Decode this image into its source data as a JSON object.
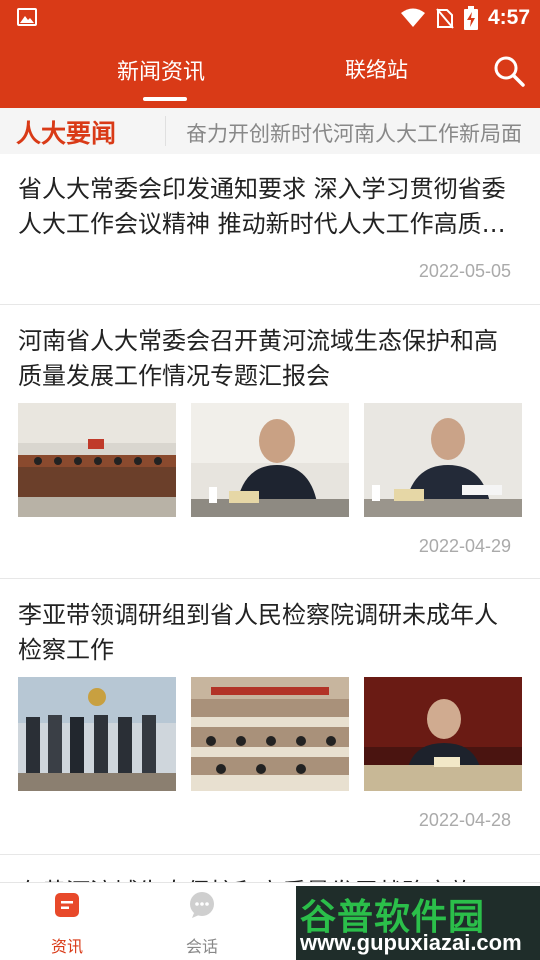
{
  "status_bar": {
    "time": "4:57",
    "icons": [
      "gallery-icon",
      "wifi-icon",
      "no-sim-icon",
      "battery-charging-icon"
    ]
  },
  "header": {
    "tabs": [
      {
        "label": "新闻资讯",
        "active": true
      },
      {
        "label": "联络站",
        "active": false
      }
    ],
    "search_icon": "search-icon",
    "accent_color": "#d93a17"
  },
  "marquee": {
    "label": "人大要闻",
    "text": "奋力开创新时代河南人大工作新局面"
  },
  "articles": [
    {
      "title": "省人大常委会印发通知要求 深入学习贯彻省委人大工作会议精神 推动新时代人大工作高质量发展",
      "date": "2022-05-05"
    },
    {
      "title": "河南省人大常委会召开黄河流域生态保护和高质量发展工作情况专题汇报会",
      "date": "2022-04-29",
      "images": [
        "meeting-room-photo",
        "speaker-photo",
        "speaker-photo"
      ]
    },
    {
      "title": "李亚带领调研组到省人民检察院调研未成年人检察工作",
      "date": "2022-04-28",
      "images": [
        "group-photo",
        "conference-hall-photo",
        "speaker-photo"
      ]
    }
  ],
  "next_article_peek": "在黄河流域生态保护和高质量发展战略实施",
  "bottom_nav": {
    "items": [
      {
        "label": "资讯",
        "icon": "news-icon",
        "active": true
      },
      {
        "label": "会话",
        "icon": "chat-icon",
        "active": false
      }
    ]
  },
  "watermark": {
    "name": "谷普软件园",
    "url": "www.gupuxiazai.com"
  }
}
